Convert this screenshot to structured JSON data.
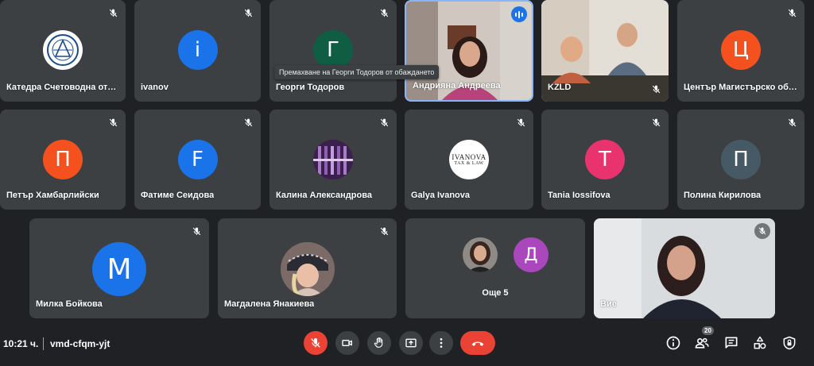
{
  "tiles": [
    {
      "name": "Катедра Счетоводна отч…",
      "avatar_kind": "logo"
    },
    {
      "name": "ivanov",
      "initial": "i",
      "color": "#1a73e8"
    },
    {
      "name": "Георги Тодоров",
      "initial": "Г",
      "color": "#0f5d43"
    },
    {
      "name": "Андрияна Андреева",
      "kind": "video",
      "speaking": true
    },
    {
      "name": "KZLD",
      "kind": "video"
    },
    {
      "name": "Център Магистърско обу…",
      "initial": "Ц",
      "color": "#f4511e"
    },
    {
      "name": "Петър Хамбарлийски",
      "initial": "П",
      "color": "#f4511e"
    },
    {
      "name": "Фатиме Сеидова",
      "initial": "F",
      "color": "#1a73e8"
    },
    {
      "name": "Калина Александрова",
      "avatar_kind": "photo"
    },
    {
      "name": "Galya Ivanova",
      "avatar_kind": "logo-text",
      "logo_line1": "IVANOVA",
      "logo_line2": "TAX & LAW"
    },
    {
      "name": "Tania Iossifova",
      "initial": "T",
      "color": "#e8336f"
    },
    {
      "name": "Полина Кирилова",
      "initial": "П",
      "color": "#455a64"
    },
    {
      "name": "Милка Бойкова",
      "initial": "M",
      "color": "#1a73e8"
    },
    {
      "name": "Магдалена Янакиева",
      "avatar_kind": "photo"
    },
    {
      "name": "Още 5",
      "kind": "overflow",
      "initial": "Д",
      "color": "#ab47bc"
    },
    {
      "name": "Вие",
      "kind": "video-self"
    }
  ],
  "tooltip": "Премахване на Георги Тодоров от обаждането",
  "bottom_bar": {
    "time": "10:21 ч.",
    "meeting_code": "vmd-cfqm-yjt",
    "participants_count": "20"
  },
  "icons": {
    "muted": "mic-off-icon",
    "speaking": "audio-level-icon",
    "mic": "mic-off-icon",
    "camera": "camera-icon",
    "hand": "raise-hand-icon",
    "present": "present-screen-icon",
    "more": "more-vert-icon",
    "end": "call-end-icon",
    "info": "info-icon",
    "people": "people-icon",
    "chat": "chat-icon",
    "activities": "activities-icon",
    "lock": "host-controls-icon"
  },
  "colors": {
    "danger": "#ea4335",
    "accent": "#1a73e8",
    "tile": "#3c4043",
    "background": "#202124"
  }
}
